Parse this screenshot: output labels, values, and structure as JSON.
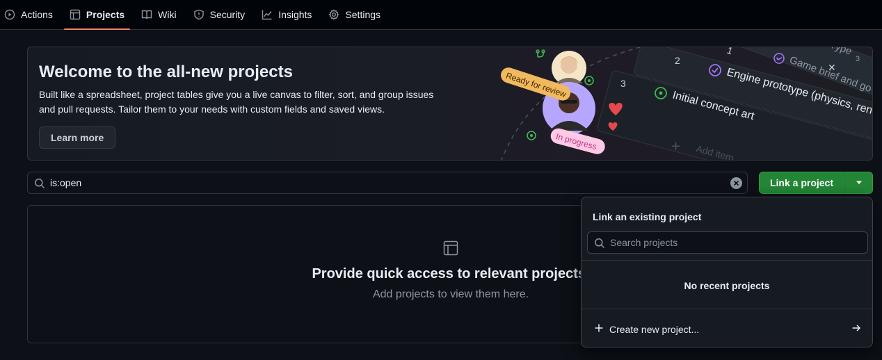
{
  "nav": {
    "items": [
      {
        "label": "Actions",
        "icon": "play-circle-icon"
      },
      {
        "label": "Projects",
        "icon": "table-icon",
        "active": true
      },
      {
        "label": "Wiki",
        "icon": "book-icon"
      },
      {
        "label": "Security",
        "icon": "shield-icon"
      },
      {
        "label": "Insights",
        "icon": "graph-icon"
      },
      {
        "label": "Settings",
        "icon": "gear-icon"
      }
    ]
  },
  "banner": {
    "title": "Welcome to the all-new projects",
    "description": "Built like a spreadsheet, project tables give you a live canvas to filter, sort, and group issues and pull requests. Tailor them to your needs with custom fields and saved views.",
    "learn_more": "Learn more",
    "art": {
      "badge_review": "Ready for review",
      "badge_progress": "In progress",
      "rows": [
        {
          "num": "1",
          "text": "Game brief and go-no"
        },
        {
          "num": "2",
          "text": "Engine prototype (physics, rendering"
        },
        {
          "num": "3",
          "text": "Initial concept art"
        }
      ],
      "add_item": "Add item",
      "type_label": "Type",
      "type_count": "3"
    }
  },
  "search": {
    "value": "is:open"
  },
  "link_button": {
    "label": "Link a project"
  },
  "empty_state": {
    "title": "Provide quick access to relevant projects.",
    "subtitle": "Add projects to view them here."
  },
  "dropdown": {
    "title": "Link an existing project",
    "search_placeholder": "Search projects",
    "empty_message": "No recent projects",
    "create_label": "Create new project..."
  },
  "colors": {
    "accent_tab": "#f78166",
    "primary_button": "#238636",
    "background": "#0d1117",
    "border": "#30363d"
  }
}
